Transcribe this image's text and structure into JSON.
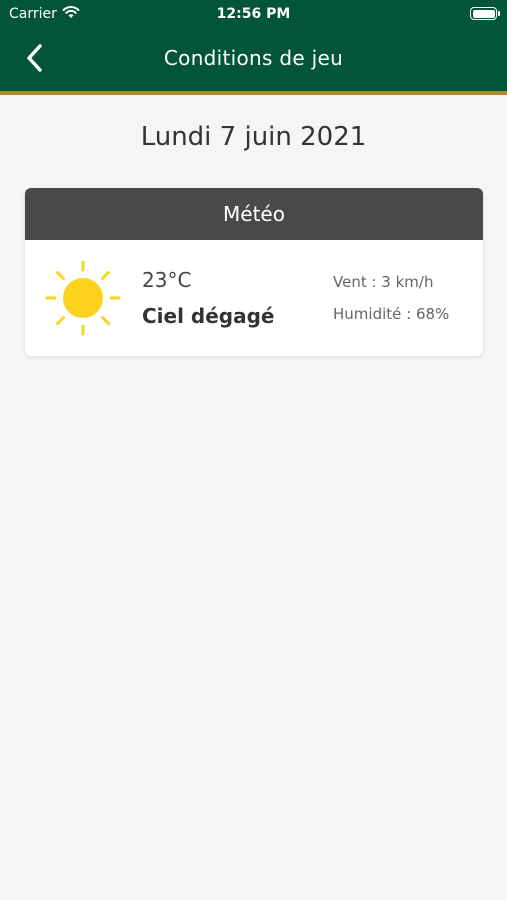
{
  "status_bar": {
    "carrier": "Carrier",
    "time": "12:56 PM"
  },
  "header": {
    "title": "Conditions de jeu"
  },
  "date": "Lundi 7 juin 2021",
  "weather": {
    "heading": "Météo",
    "temperature": "23°C",
    "sky": "Ciel dégagé",
    "wind": "Vent : 3 km/h",
    "humidity": "Humidité : 68%",
    "icon": "sun-icon"
  },
  "colors": {
    "header_bg": "#02553a",
    "header_border": "#b08a2e",
    "card_header_bg": "#494949",
    "sun": "#fcd21d"
  }
}
